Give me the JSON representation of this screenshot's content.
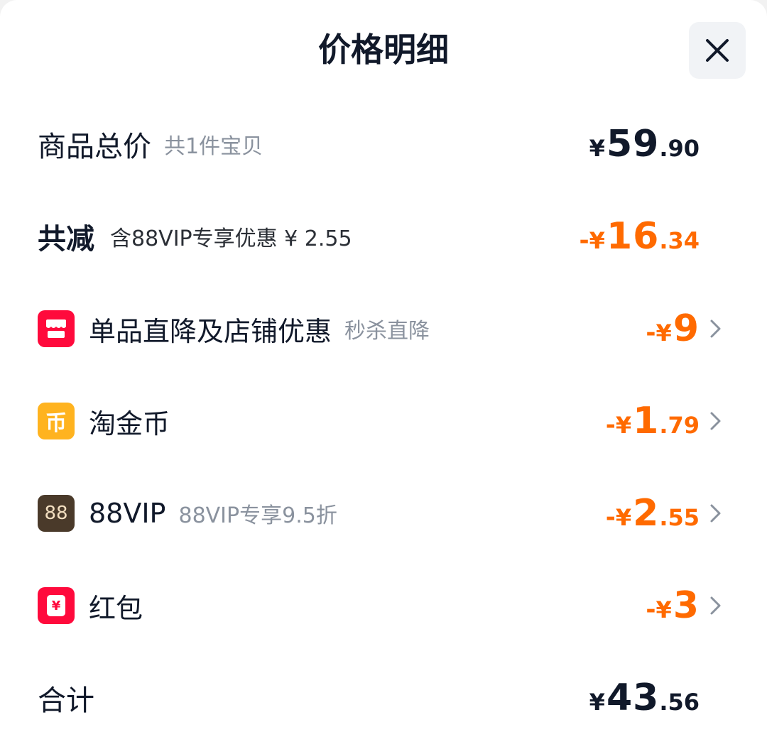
{
  "header": {
    "title": "价格明细",
    "close_icon": "close-icon"
  },
  "summary": {
    "total": {
      "label": "商品总价",
      "note": "共1件宝贝",
      "currency": "¥",
      "integer": "59",
      "decimal": ".90"
    },
    "reduction": {
      "label": "共减",
      "note": "含88VIP专享优惠 ¥ 2.55",
      "sign": "-",
      "currency": "¥",
      "integer": "16",
      "decimal": ".34"
    }
  },
  "items": [
    {
      "icon": "store-icon",
      "label": "单品直降及店铺优惠",
      "note": "秒杀直降",
      "sign": "-",
      "currency": "¥",
      "integer": "9",
      "decimal": ""
    },
    {
      "icon": "coin-icon",
      "icon_text": "币",
      "label": "淘金币",
      "note": "",
      "sign": "-",
      "currency": "¥",
      "integer": "1",
      "decimal": ".79"
    },
    {
      "icon": "vip-88-icon",
      "icon_text": "88",
      "label": "88VIP",
      "note": "88VIP专享9.5折",
      "sign": "-",
      "currency": "¥",
      "integer": "2",
      "decimal": ".55"
    },
    {
      "icon": "red-packet-icon",
      "icon_text": "¥",
      "label": "红包",
      "note": "",
      "sign": "-",
      "currency": "¥",
      "integer": "3",
      "decimal": ""
    }
  ],
  "footer": {
    "label": "合计",
    "currency": "¥",
    "integer": "43",
    "decimal": ".56"
  },
  "colors": {
    "text_primary": "#11192a",
    "text_secondary": "#8a929e",
    "discount_orange": "#ff6a00",
    "icon_red": "#ff0a3c",
    "icon_yellow": "#ffb31f",
    "icon_vip": "#4a3a2a"
  }
}
